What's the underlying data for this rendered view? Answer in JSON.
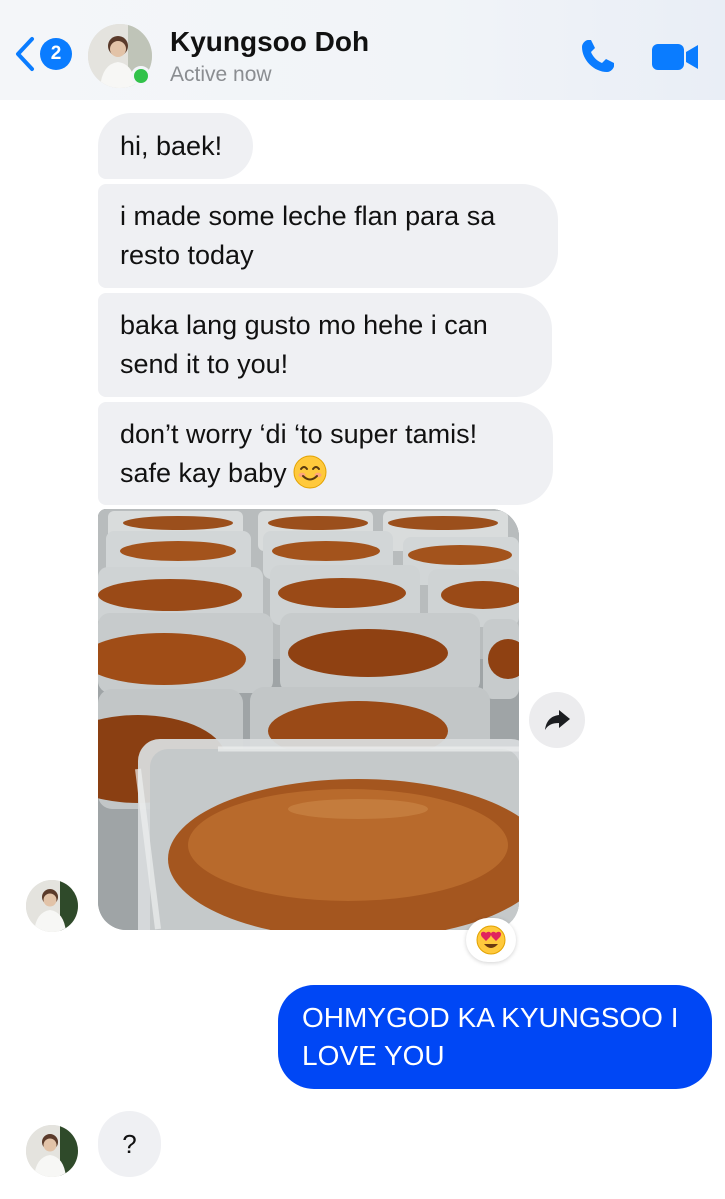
{
  "header": {
    "back_badge": "2",
    "contact_name": "Kyungsoo Doh",
    "status": "Active now",
    "icons": [
      "back-chevron-icon",
      "phone-icon",
      "video-camera-icon"
    ],
    "accent_color": "#0a7cff",
    "online_color": "#31c24a"
  },
  "messages": {
    "received": [
      {
        "lines": [
          "hi, baek!"
        ]
      },
      {
        "lines": [
          "i made some leche flan para sa",
          "resto today"
        ]
      },
      {
        "lines": [
          "baka lang gusto mo hehe i can",
          "send it to you!"
        ]
      },
      {
        "lines": [
          "don’t worry ‘di ‘to super tamis!",
          "safe kay baby"
        ],
        "emoji": "smiling-face-icon"
      }
    ],
    "photo": {
      "reaction": "heart-eyes-icon"
    },
    "sent": {
      "lines": [
        "OHMYGOD KA KYUNGSOO I",
        "LOVE YOU"
      ],
      "color": "#0047f5"
    },
    "last_received": {
      "lines": [
        "?"
      ]
    }
  }
}
